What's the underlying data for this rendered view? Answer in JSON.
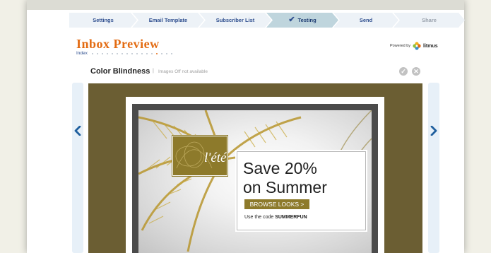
{
  "steps": [
    {
      "label": "Settings",
      "state": "normal"
    },
    {
      "label": "Email Template",
      "state": "normal"
    },
    {
      "label": "Subscriber List",
      "state": "normal"
    },
    {
      "label": "Testing",
      "state": "active"
    },
    {
      "label": "Send",
      "state": "normal"
    },
    {
      "label": "Share",
      "state": "disabled"
    }
  ],
  "header": {
    "title": "Inbox Preview",
    "index_label": "Index",
    "index_total": 17,
    "index_current": 14,
    "powered_by": "Powered by",
    "brand": "litmus"
  },
  "client": {
    "name": "Color Blindness",
    "separator": "|",
    "note": "Images Off not available"
  },
  "email": {
    "logo_text": "l'été",
    "headline_line1": "Save 20%",
    "headline_line2": "on Summer",
    "button": "BROWSE LOOKS >",
    "code_prefix": "Use the code",
    "code": "SUMMERFUN"
  },
  "icons": {
    "step_done": "check-icon",
    "approve": "check-circle-icon",
    "reject": "close-circle-icon",
    "prev": "chevron-left-icon",
    "next": "chevron-right-icon"
  },
  "colors": {
    "accent": "#e36b12",
    "nav_text": "#2f4f8f",
    "preview_background": "#6b5e33",
    "email_gold": "#8d7a2b"
  }
}
